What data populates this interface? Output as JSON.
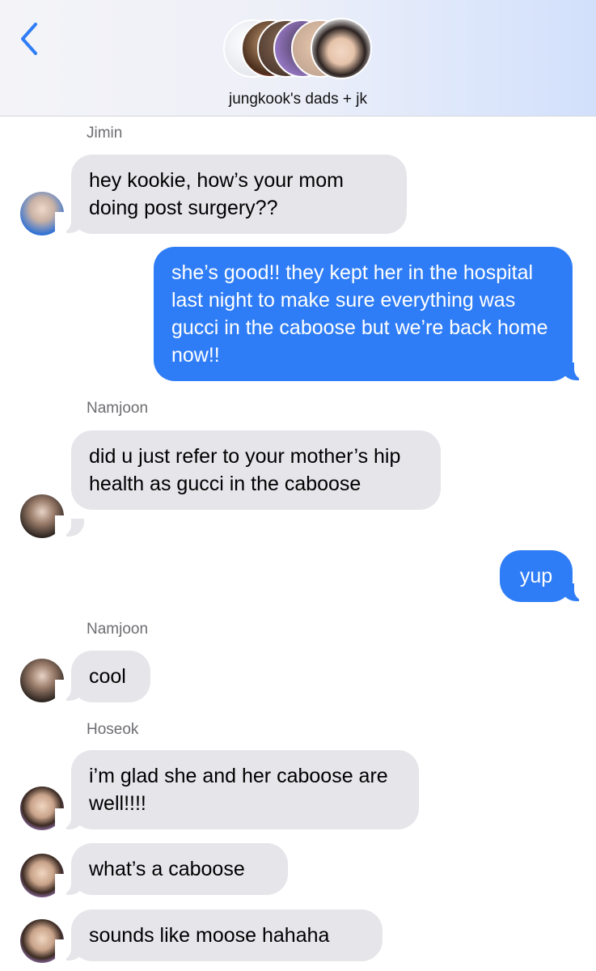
{
  "header": {
    "group_name": "jungkook's dads + jk",
    "accent_color": "#2f7df6"
  },
  "messages": [
    {
      "sender": "Jimin",
      "text": "hey kookie, how’s your mom doing post surgery??"
    },
    {
      "sender": "me",
      "text": "she’s good!! they kept her in the hospital last night to make sure everything was gucci in the caboose but we’re back home now!!"
    },
    {
      "sender": "Namjoon",
      "text": "did u just refer to your mother’s hip health as gucci in the caboose"
    },
    {
      "sender": "me",
      "text": "yup"
    },
    {
      "sender": "Namjoon",
      "text": "cool"
    },
    {
      "sender": "Hoseok",
      "text": "i’m glad she and her caboose are well!!!!"
    },
    {
      "sender": "Hoseok",
      "text": "what’s a caboose"
    },
    {
      "sender": "Hoseok",
      "text": "sounds like moose hahaha"
    }
  ]
}
